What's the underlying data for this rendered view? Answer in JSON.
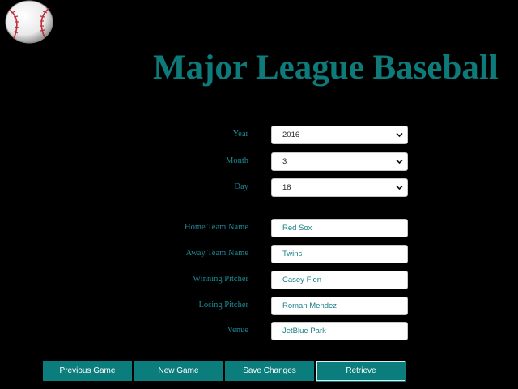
{
  "header": {
    "title": "Major League Baseball",
    "logo_icon": "baseball-icon"
  },
  "form": {
    "year": {
      "label": "Year",
      "value": "2016"
    },
    "month": {
      "label": "Month",
      "value": "3"
    },
    "day": {
      "label": "Day",
      "value": "18"
    },
    "home_team": {
      "label": "Home Team Name",
      "value": "Red Sox"
    },
    "away_team": {
      "label": "Away Team Name",
      "value": "Twins"
    },
    "winning_pitcher": {
      "label": "Winning Pitcher",
      "value": "Casey Fien"
    },
    "losing_pitcher": {
      "label": "Losing Pitcher",
      "value": "Roman Mendez"
    },
    "venue": {
      "label": "Venue",
      "value": "JetBlue Park"
    }
  },
  "buttons": {
    "previous_game": "Previous Game",
    "new_game": "New Game",
    "save_changes": "Save Changes",
    "retrieve": "Retrieve"
  },
  "colors": {
    "background": "#000000",
    "accent": "#0c7d7d",
    "title": "#0e7a7a",
    "label": "#1b8a96"
  }
}
